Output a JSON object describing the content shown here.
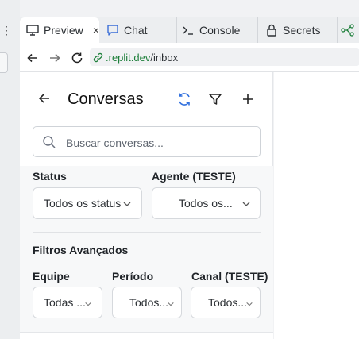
{
  "tabs": [
    {
      "label": "Preview",
      "icon": "monitor-icon",
      "active": true,
      "close": "×"
    },
    {
      "label": "Chat",
      "icon": "chat-icon"
    },
    {
      "label": "Console",
      "icon": "terminal-icon"
    },
    {
      "label": "Secrets",
      "icon": "lock-icon"
    }
  ],
  "address": {
    "host": ".replit.dev",
    "path": "/inbox"
  },
  "left_strip": {
    "dots": "⋮"
  },
  "header": {
    "title": "Conversas",
    "accent": "#2f6fde"
  },
  "search": {
    "placeholder": "Buscar conversas..."
  },
  "filters": {
    "status_label": "Status",
    "status_value": "Todos os status",
    "agent_label": "Agente (TESTE)",
    "agent_value": "Todos os...",
    "advanced_title": "Filtros Avançados",
    "team_label": "Equipe",
    "team_value": "Todas ...",
    "period_label": "Período",
    "period_value": "Todos...",
    "channel_label": "Canal (TESTE)",
    "channel_value": "Todos..."
  }
}
